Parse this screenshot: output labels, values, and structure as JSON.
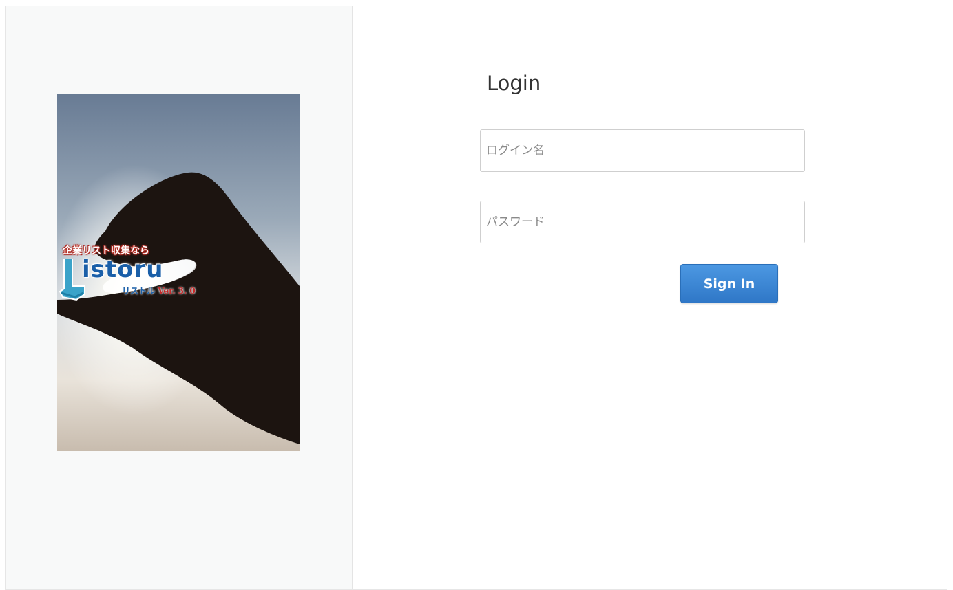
{
  "brand": {
    "tagline": "企業リスト収集なら",
    "name": "istoru",
    "sub_jp": "リストル",
    "version": "Ver. 3. 0"
  },
  "login": {
    "title": "Login",
    "username_placeholder": "ログイン名",
    "password_placeholder": "パスワード",
    "signin_label": "Sign In"
  },
  "colors": {
    "button_blue": "#3a85d6",
    "brand_blue": "#1a5fa8",
    "brand_red": "#c62828",
    "left_panel_bg": "#f8f9f9"
  },
  "icons": {
    "logo_mark": "L-shaped-logo-icon"
  }
}
